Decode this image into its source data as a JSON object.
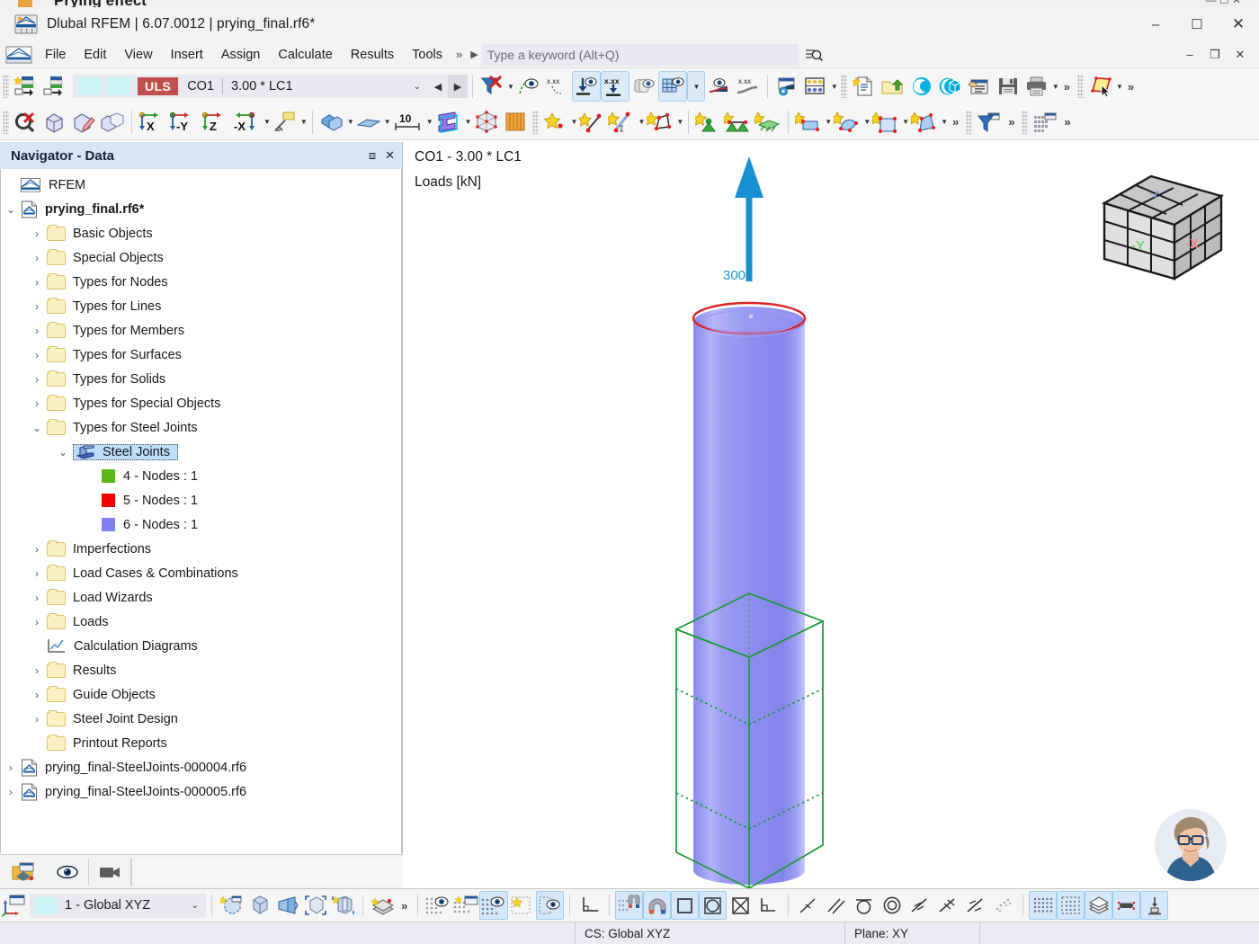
{
  "behind_window": {
    "title": "Prying effect"
  },
  "titlebar": {
    "title": "Dlubal RFEM | 6.07.0012 | prying_final.rf6*",
    "logo_icon": "rfem-logo-icon",
    "minimize": "–",
    "maximize": "☐",
    "close": "✕"
  },
  "menubar": {
    "logo_icon": "rfem-small-logo-icon",
    "items": [
      "File",
      "Edit",
      "View",
      "Insert",
      "Assign",
      "Calculate",
      "Results",
      "Tools"
    ],
    "overflow_chevron": "»",
    "play_glyph": "▶",
    "search_placeholder": "Type a keyword (Alt+Q)",
    "search_value": "",
    "search_icon": "magnifier-with-lines-icon",
    "window_minimize": "–",
    "window_restore": "❐",
    "window_close": "✕"
  },
  "toolbar_row1": {
    "load_case": {
      "uls_badge": "ULS",
      "combination": "CO1",
      "expression": "3.00 * LC1",
      "dropdown_caret": "⌄",
      "prev_glyph": "◀",
      "next_glyph": "▶"
    },
    "overflow": "»"
  },
  "toolbar_row2": {
    "axis_buttons": [
      "X",
      "-Y",
      "Z",
      "-X"
    ],
    "scale_label": "10",
    "overflow": "»"
  },
  "navigator": {
    "title": "Navigator - Data",
    "restore_icon": "restore-panel-icon",
    "close_icon": "close-panel-icon",
    "tree": [
      {
        "label": "RFEM",
        "indent": 0,
        "twisty": "",
        "icon": "rfem-icon",
        "bold": false
      },
      {
        "label": "prying_final.rf6*",
        "indent": 0,
        "twisty": "⌄",
        "icon": "model-file-icon",
        "bold": true
      },
      {
        "label": "Basic Objects",
        "indent": 1,
        "twisty": "›",
        "icon": "folder",
        "bold": false
      },
      {
        "label": "Special Objects",
        "indent": 1,
        "twisty": "›",
        "icon": "folder",
        "bold": false
      },
      {
        "label": "Types for Nodes",
        "indent": 1,
        "twisty": "›",
        "icon": "folder",
        "bold": false
      },
      {
        "label": "Types for Lines",
        "indent": 1,
        "twisty": "›",
        "icon": "folder",
        "bold": false
      },
      {
        "label": "Types for Members",
        "indent": 1,
        "twisty": "›",
        "icon": "folder",
        "bold": false
      },
      {
        "label": "Types for Surfaces",
        "indent": 1,
        "twisty": "›",
        "icon": "folder",
        "bold": false
      },
      {
        "label": "Types for Solids",
        "indent": 1,
        "twisty": "›",
        "icon": "folder",
        "bold": false
      },
      {
        "label": "Types for Special Objects",
        "indent": 1,
        "twisty": "›",
        "icon": "folder",
        "bold": false
      },
      {
        "label": "Types for Steel Joints",
        "indent": 1,
        "twisty": "⌄",
        "icon": "folder",
        "bold": false
      },
      {
        "label": "Steel Joints",
        "indent": 2,
        "twisty": "⌄",
        "icon": "steel-joint-icon",
        "bold": false,
        "selected": true
      },
      {
        "label": "4 - Nodes : 1",
        "indent": 3,
        "twisty": "",
        "icon": "swatch",
        "color": "#5db715",
        "bold": false
      },
      {
        "label": "5 - Nodes : 1",
        "indent": 3,
        "twisty": "",
        "icon": "swatch",
        "color": "#f90000",
        "bold": false
      },
      {
        "label": "6 - Nodes : 1",
        "indent": 3,
        "twisty": "",
        "icon": "swatch",
        "color": "#8080f5",
        "bold": false
      },
      {
        "label": "Imperfections",
        "indent": 1,
        "twisty": "›",
        "icon": "folder",
        "bold": false
      },
      {
        "label": "Load Cases & Combinations",
        "indent": 1,
        "twisty": "›",
        "icon": "folder",
        "bold": false
      },
      {
        "label": "Load Wizards",
        "indent": 1,
        "twisty": "›",
        "icon": "folder",
        "bold": false
      },
      {
        "label": "Loads",
        "indent": 1,
        "twisty": "›",
        "icon": "folder",
        "bold": false
      },
      {
        "label": "Calculation Diagrams",
        "indent": 1,
        "twisty": "",
        "icon": "diagram-icon",
        "bold": false
      },
      {
        "label": "Results",
        "indent": 1,
        "twisty": "›",
        "icon": "folder",
        "bold": false
      },
      {
        "label": "Guide Objects",
        "indent": 1,
        "twisty": "›",
        "icon": "folder",
        "bold": false
      },
      {
        "label": "Steel Joint Design",
        "indent": 1,
        "twisty": "›",
        "icon": "folder",
        "bold": false
      },
      {
        "label": "Printout Reports",
        "indent": 1,
        "twisty": "",
        "icon": "folder",
        "bold": false
      },
      {
        "label": "prying_final-SteelJoints-000004.rf6",
        "indent": 0,
        "twisty": "›",
        "icon": "model-file-icon",
        "bold": false
      },
      {
        "label": "prying_final-SteelJoints-000005.rf6",
        "indent": 0,
        "twisty": "›",
        "icon": "model-file-icon",
        "bold": false
      }
    ],
    "footer": {
      "data_icon": "navigator-data-icon",
      "display_icon": "eye-icon",
      "camera_icon": "camera-icon"
    }
  },
  "viewport": {
    "label_line1": "CO1 - 3.00 * LC1",
    "label_line2": "Loads [kN]",
    "load_arrow_value": "300",
    "load_arrow_color": "#1890d0",
    "model": {
      "pipe_color": "#8b8bf0",
      "pipe_top_ring_color": "#dd2222",
      "joint_box_color": "#1a9a36",
      "description": "vertical circular hollow section column with steel joint bounding box"
    },
    "viewcube": {
      "face_left": "-Y",
      "face_right": "-X",
      "face_top": "-Z",
      "color_left": "#6fd36f",
      "color_right": "#ef8585",
      "color_top": "#9a9ae8"
    },
    "avatar_name": "support-assistant-avatar"
  },
  "bottombar": {
    "cs_select": {
      "value": "1 - Global XYZ",
      "caret": "⌄"
    },
    "overflow": "»"
  },
  "statusbar": {
    "coordinate_system": "CS: Global XYZ",
    "plane": "Plane: XY"
  }
}
